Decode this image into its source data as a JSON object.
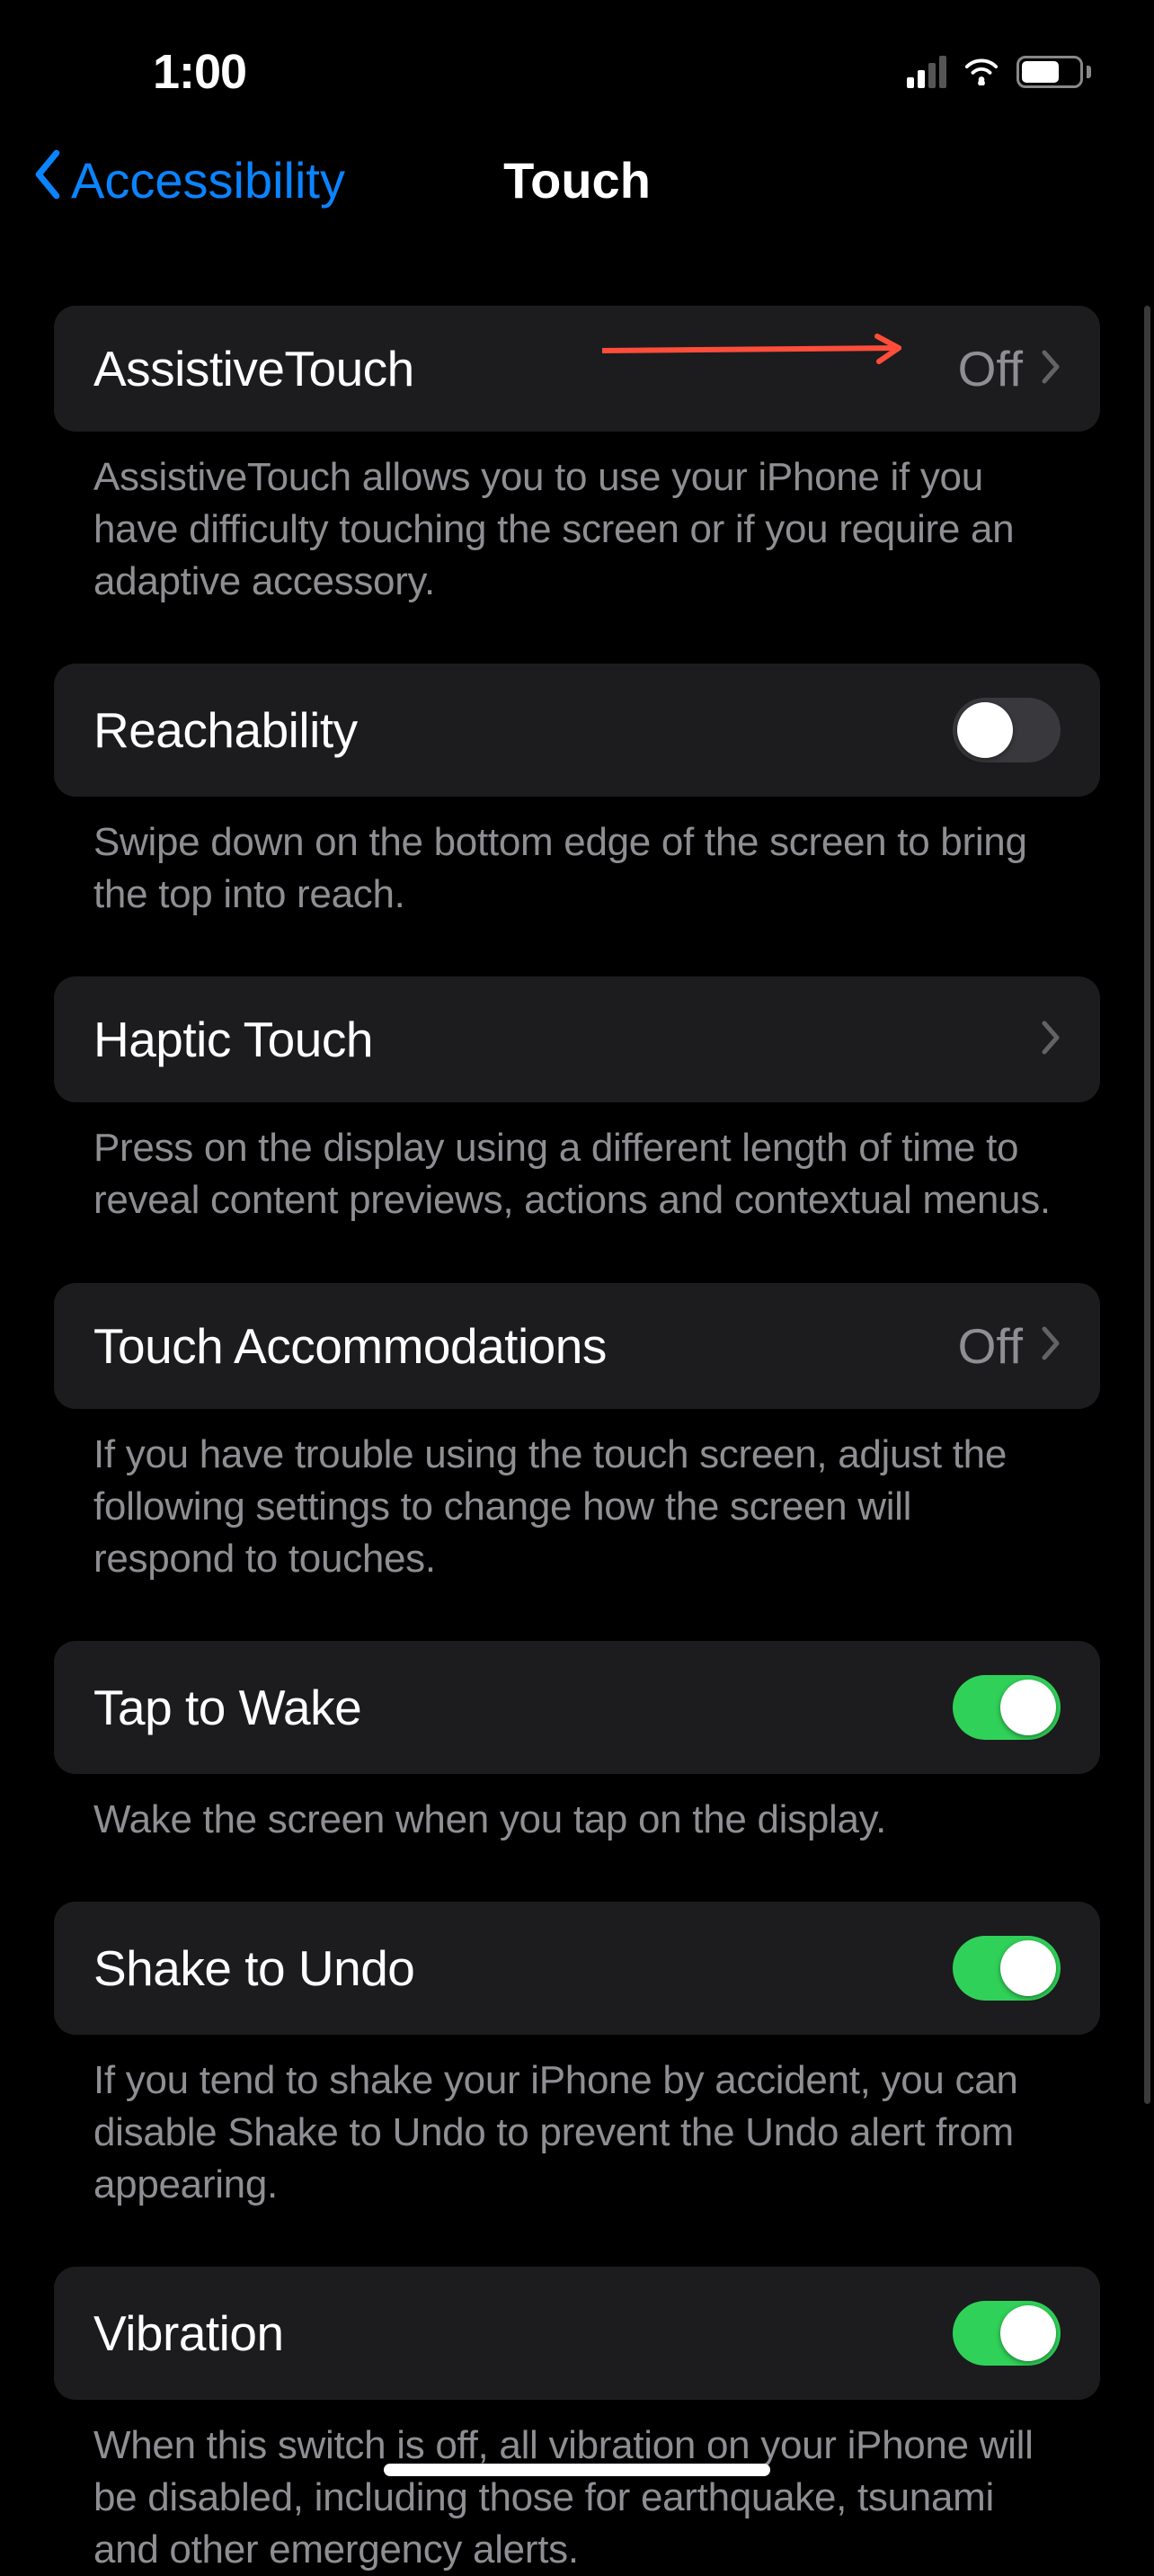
{
  "status": {
    "time": "1:00"
  },
  "nav": {
    "back_label": "Accessibility",
    "title": "Touch"
  },
  "sections": {
    "assistivetouch": {
      "label": "AssistiveTouch",
      "value": "Off",
      "footer": "AssistiveTouch allows you to use your iPhone if you have difficulty touching the screen or if you require an adaptive accessory."
    },
    "reachability": {
      "label": "Reachability",
      "switch_on": false,
      "footer": "Swipe down on the bottom edge of the screen to bring the top into reach."
    },
    "haptic": {
      "label": "Haptic Touch",
      "footer": "Press on the display using a different length of time to reveal content previews, actions and contextual menus."
    },
    "accommodations": {
      "label": "Touch Accommodations",
      "value": "Off",
      "footer": "If you have trouble using the touch screen, adjust the following settings to change how the screen will respond to touches."
    },
    "tap_wake": {
      "label": "Tap to Wake",
      "switch_on": true,
      "footer": "Wake the screen when you tap on the display."
    },
    "shake_undo": {
      "label": "Shake to Undo",
      "switch_on": true,
      "footer": "If you tend to shake your iPhone by accident, you can disable Shake to Undo to prevent the Undo alert from appearing."
    },
    "vibration": {
      "label": "Vibration",
      "switch_on": true,
      "footer": "When this switch is off, all vibration on your iPhone will be disabled, including those for earthquake, tsunami and other emergency alerts."
    }
  }
}
